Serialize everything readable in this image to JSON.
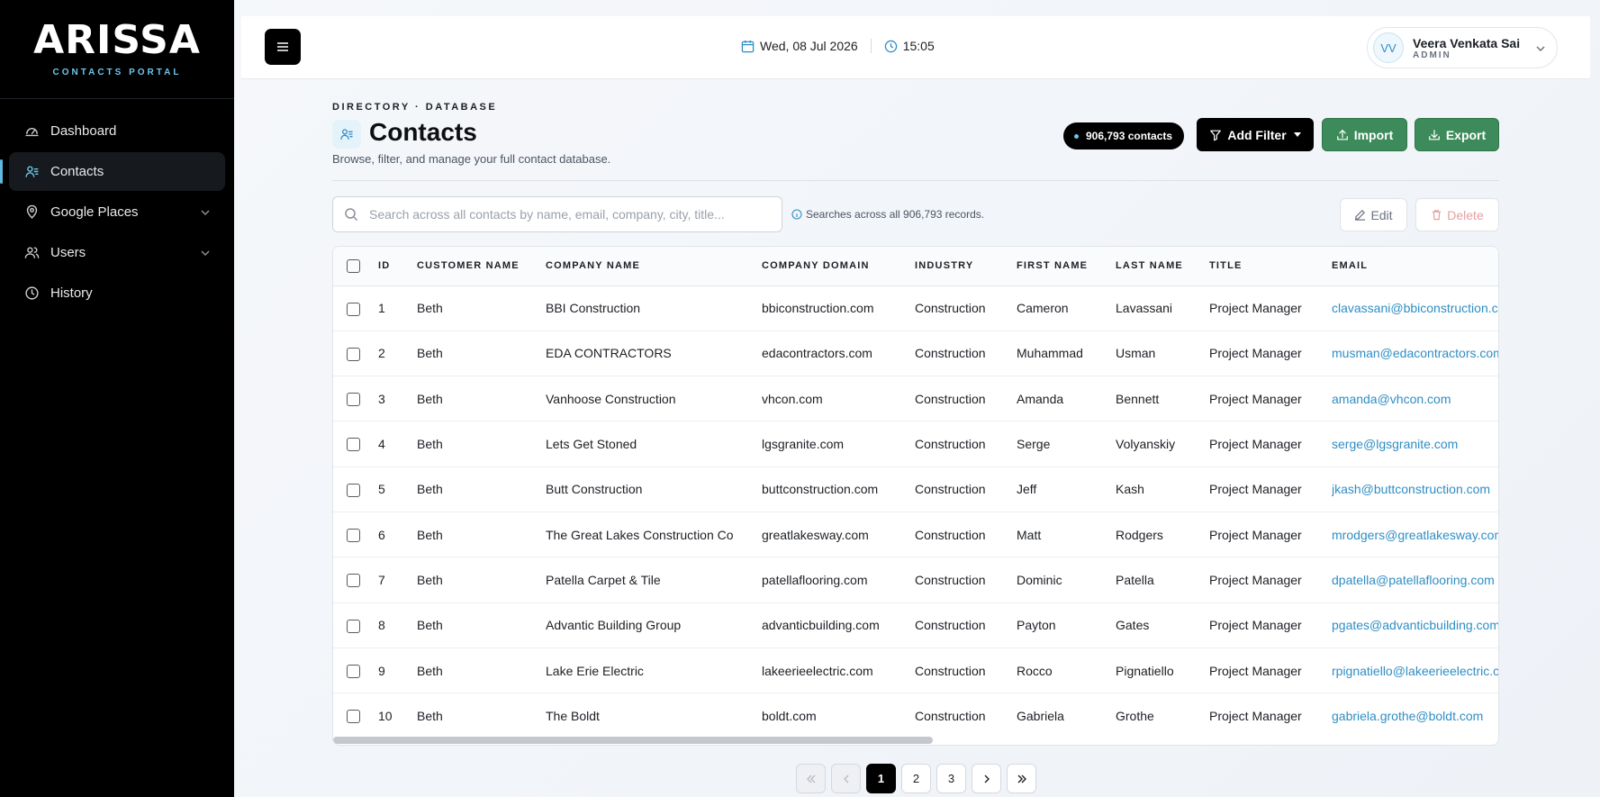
{
  "brand": {
    "name": "ARISSA",
    "subtitle": "CONTACTS PORTAL"
  },
  "sidebar": {
    "items": [
      {
        "label": "Dashboard",
        "icon": "gauge-icon"
      },
      {
        "label": "Contacts",
        "icon": "contacts-icon",
        "active": true
      },
      {
        "label": "Google Places",
        "icon": "map-pin-icon",
        "expandable": true
      },
      {
        "label": "Users",
        "icon": "users-icon",
        "expandable": true
      },
      {
        "label": "History",
        "icon": "clock-icon"
      }
    ]
  },
  "topbar": {
    "date": "Wed, 08 Jul 2026",
    "time": "15:05",
    "user": {
      "initials": "VV",
      "name": "Veera Venkata Sai",
      "role": "ADMIN"
    }
  },
  "header": {
    "eyebrow": "DIRECTORY · DATABASE",
    "title": "Contacts",
    "description": "Browse, filter, and manage your full contact database.",
    "count_badge": "906,793 contacts",
    "add_filter_label": "Add Filter",
    "import_label": "Import",
    "export_label": "Export"
  },
  "search": {
    "placeholder": "Search across all contacts by name, email, company, city, title...",
    "value": "",
    "hint": "Searches across all 906,793 records."
  },
  "actions": {
    "edit_label": "Edit",
    "delete_label": "Delete"
  },
  "table": {
    "columns": [
      "ID",
      "CUSTOMER NAME",
      "COMPANY NAME",
      "COMPANY DOMAIN",
      "INDUSTRY",
      "FIRST NAME",
      "LAST NAME",
      "TITLE",
      "EMAIL"
    ],
    "rows": [
      [
        "1",
        "Beth",
        "BBI Construction",
        "bbiconstruction.com",
        "Construction",
        "Cameron",
        "Lavassani",
        "Project Manager",
        "clavassani@bbiconstruction.com"
      ],
      [
        "2",
        "Beth",
        "EDA CONTRACTORS",
        "edacontractors.com",
        "Construction",
        "Muhammad",
        "Usman",
        "Project Manager",
        "musman@edacontractors.com"
      ],
      [
        "3",
        "Beth",
        "Vanhoose Construction",
        "vhcon.com",
        "Construction",
        "Amanda",
        "Bennett",
        "Project Manager",
        "amanda@vhcon.com"
      ],
      [
        "4",
        "Beth",
        "Lets Get Stoned",
        "lgsgranite.com",
        "Construction",
        "Serge",
        "Volyanskiy",
        "Project Manager",
        "serge@lgsgranite.com"
      ],
      [
        "5",
        "Beth",
        "Butt Construction",
        "buttconstruction.com",
        "Construction",
        "Jeff",
        "Kash",
        "Project Manager",
        "jkash@buttconstruction.com"
      ],
      [
        "6",
        "Beth",
        "The Great Lakes Construction Co",
        "greatlakesway.com",
        "Construction",
        "Matt",
        "Rodgers",
        "Project Manager",
        "mrodgers@greatlakesway.com"
      ],
      [
        "7",
        "Beth",
        "Patella Carpet & Tile",
        "patellaflooring.com",
        "Construction",
        "Dominic",
        "Patella",
        "Project Manager",
        "dpatella@patellaflooring.com"
      ],
      [
        "8",
        "Beth",
        "Advantic Building Group",
        "advanticbuilding.com",
        "Construction",
        "Payton",
        "Gates",
        "Project Manager",
        "pgates@advanticbuilding.com"
      ],
      [
        "9",
        "Beth",
        "Lake Erie Electric",
        "lakeerieelectric.com",
        "Construction",
        "Rocco",
        "Pignatiello",
        "Project Manager",
        "rpignatiello@lakeerieelectric.com"
      ],
      [
        "10",
        "Beth",
        "The Boldt",
        "boldt.com",
        "Construction",
        "Gabriela",
        "Grothe",
        "Project Manager",
        "gabriela.grothe@boldt.com"
      ]
    ]
  },
  "pagination": {
    "pages": [
      "1",
      "2",
      "3"
    ],
    "current": "1"
  },
  "colors": {
    "accent": "#6cc6ee",
    "link": "#2f8ec4",
    "success": "#3d8b5a",
    "sidebar_bg": "#000000"
  }
}
